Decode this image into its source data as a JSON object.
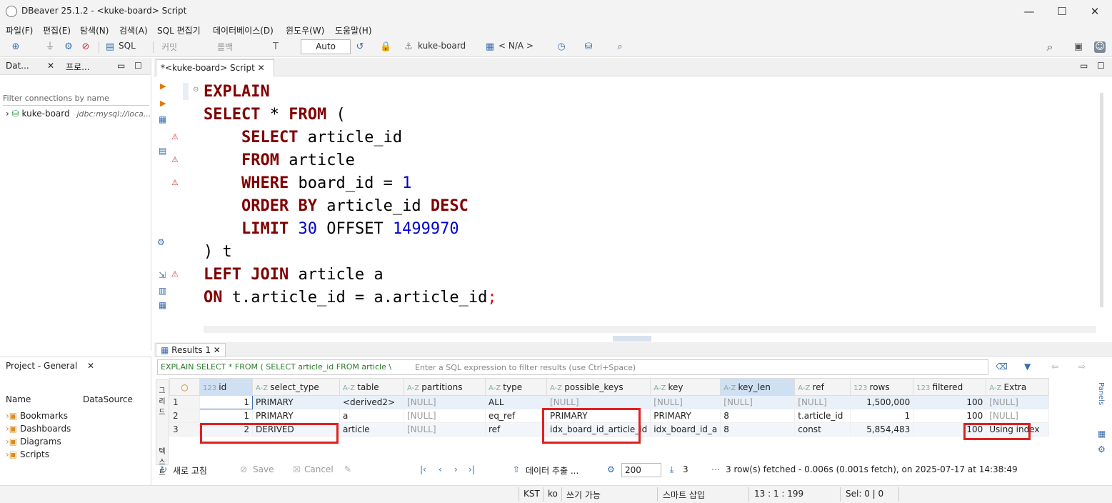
{
  "window": {
    "title": "DBeaver 25.1.2 - <kuke-board> Script"
  },
  "menu": [
    "파일(F)",
    "편집(E)",
    "탐색(N)",
    "검색(A)",
    "SQL 편집기",
    "데이터베이스(D)",
    "윈도우(W)",
    "도움말(H)"
  ],
  "toolbar": {
    "sql_label": "SQL",
    "commit_label": "커밋",
    "rollback_label": "롤백",
    "mode": "Auto",
    "connection": "kuke-board",
    "schema": "< N/A >"
  },
  "left": {
    "tab_db": "Dat...",
    "tab_proj": "프로...",
    "filter_placeholder": "Filter connections by name",
    "conn_name": "kuke-board",
    "conn_url": "jdbc:mysql://loca..."
  },
  "project": {
    "title": "Project - General",
    "col_name": "Name",
    "col_ds": "DataSource",
    "items": [
      "Bookmarks",
      "Dashboards",
      "Diagrams",
      "Scripts"
    ]
  },
  "editor": {
    "tab": "*<kuke-board> Script",
    "lines": [
      {
        "k": "EXPLAIN",
        "r": ""
      },
      {
        "k": "SELECT",
        "r": " * ",
        "k2": "FROM",
        "r2": " ("
      },
      {
        "k": "    SELECT",
        "r": " article_id"
      },
      {
        "k": "    FROM",
        "r": " article"
      },
      {
        "k": "    WHERE",
        "r": " board_id = ",
        "n": "1"
      },
      {
        "k": "    ORDER BY",
        "r": " article_id ",
        "k2": "DESC"
      },
      {
        "k": "    LIMIT",
        "r": " ",
        "n": "30",
        "r2": " OFFSET ",
        "n2": "1499970"
      },
      {
        "k": "",
        "r": ") t"
      },
      {
        "k": "LEFT JOIN",
        "r": " article a"
      },
      {
        "k": "ON",
        "r": " t.article_id = a.article_id",
        "s": ";"
      }
    ]
  },
  "results": {
    "tab": "Results 1",
    "query_label": "EXPLAIN SELECT * FROM ( SELECT article_id FROM article \\",
    "filter_placeholder": "Enter a SQL expression to filter results (use Ctrl+Space)",
    "columns": [
      "id",
      "select_type",
      "table",
      "partitions",
      "type",
      "possible_keys",
      "key",
      "key_len",
      "ref",
      "rows",
      "filtered",
      "Extra"
    ],
    "rows": [
      [
        "1",
        "1",
        "PRIMARY",
        "<derived2>",
        "[NULL]",
        "ALL",
        "[NULL]",
        "[NULL]",
        "[NULL]",
        "[NULL]",
        "1,500,000",
        "100",
        "[NULL]"
      ],
      [
        "2",
        "1",
        "PRIMARY",
        "a",
        "[NULL]",
        "eq_ref",
        "PRIMARY",
        "PRIMARY",
        "8",
        "t.article_id",
        "1",
        "100",
        "[NULL]"
      ],
      [
        "3",
        "2",
        "DERIVED",
        "article",
        "[NULL]",
        "ref",
        "idx_board_id_article_id",
        "idx_board_id_a",
        "8",
        "const",
        "5,854,483",
        "100",
        "Using index"
      ]
    ],
    "footer": {
      "refresh": "새로 고침",
      "save": "Save",
      "cancel": "Cancel",
      "export": "데이터 추출 ...",
      "limit": "200",
      "count": "3",
      "status": "3 row(s) fetched - 0.006s (0.001s fetch), on 2025-07-17 at 14:38:49"
    },
    "side_grid": "그리드",
    "side_text": "텍스트",
    "panels": "Panels"
  },
  "status": {
    "tz": "KST",
    "lang": "ko",
    "mode": "쓰기 가능",
    "insert": "스마트 삽입",
    "pos": "13 : 1 : 199",
    "sel": "Sel: 0 | 0"
  }
}
